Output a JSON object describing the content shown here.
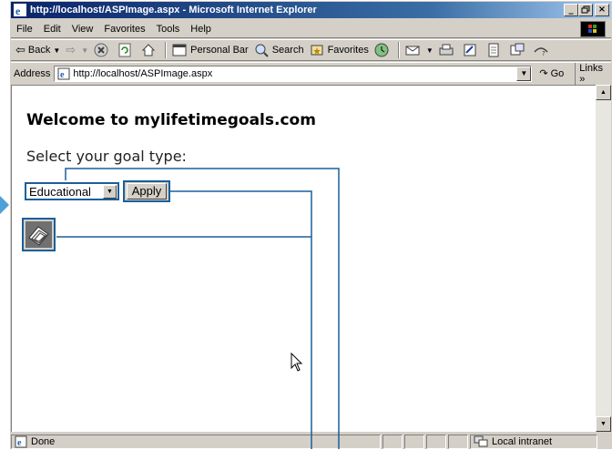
{
  "window": {
    "title": "http://localhost/ASPImage.aspx - Microsoft Internet Explorer",
    "controls": [
      "_",
      " ",
      "×"
    ]
  },
  "menu": [
    "File",
    "Edit",
    "View",
    "Favorites",
    "Tools",
    "Help"
  ],
  "toolbar": {
    "back": "Back",
    "personal_bar": "Personal Bar",
    "search": "Search",
    "favorites": "Favorites"
  },
  "address": {
    "label": "Address",
    "url": "http://localhost/ASPImage.aspx",
    "go": "Go",
    "links": "Links »"
  },
  "page": {
    "heading": "Welcome to mylifetimegoals.com",
    "prompt": "Select your goal type:",
    "goal_select_value": "Educational",
    "apply_label": "Apply"
  },
  "status": {
    "text": "Done",
    "zone": "Local intranet"
  },
  "colors": {
    "callout": "#1a5f9a",
    "title_bar": "#0a246a"
  }
}
